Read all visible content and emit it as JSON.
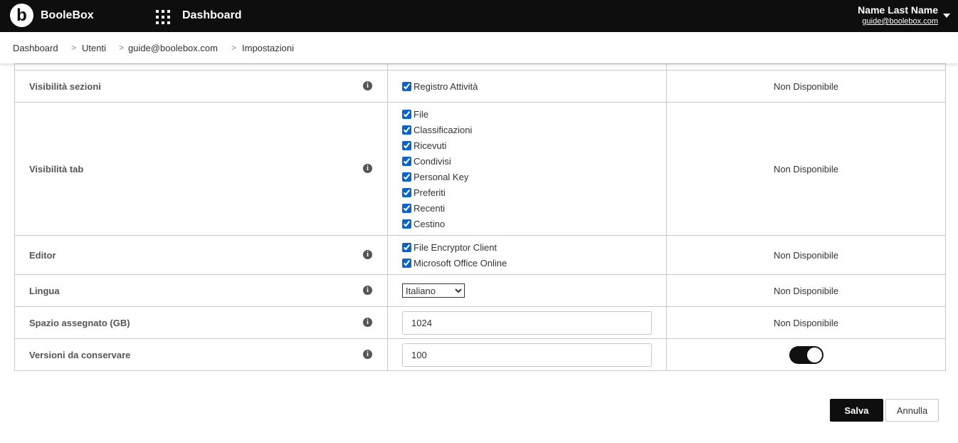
{
  "header": {
    "logo_letter": "b",
    "brand": "BooleBox",
    "nav_title": "Dashboard",
    "user_name": "Name Last Name",
    "user_email": "guide@boolebox.com"
  },
  "breadcrumb": {
    "items": [
      "Dashboard",
      "Utenti",
      "guide@boolebox.com",
      "Impostazioni"
    ],
    "separator": ">"
  },
  "info_glyph": "i",
  "rows": {
    "sections": {
      "label": "Visibilità sezioni",
      "options": [
        "Registro Attività"
      ],
      "availability": "Non Disponibile"
    },
    "tabs": {
      "label": "Visibilità tab",
      "options": [
        "File",
        "Classificazioni",
        "Ricevuti",
        "Condivisi",
        "Personal Key",
        "Preferiti",
        "Recenti",
        "Cestino"
      ],
      "availability": "Non Disponibile"
    },
    "editor": {
      "label": "Editor",
      "options": [
        "File Encryptor Client",
        "Microsoft Office Online"
      ],
      "availability": "Non Disponibile"
    },
    "language": {
      "label": "Lingua",
      "selected": "Italiano",
      "availability": "Non Disponibile"
    },
    "space": {
      "label": "Spazio assegnato (GB)",
      "value": "1024",
      "availability": "Non Disponibile"
    },
    "versions": {
      "label": "Versioni da conservare",
      "value": "100",
      "toggle_on": true
    }
  },
  "buttons": {
    "save": "Salva",
    "cancel": "Annulla"
  },
  "colors": {
    "topbar": "#0e0e0e",
    "checkbox_accent": "#0a63c9",
    "border": "#c8c8c8"
  }
}
